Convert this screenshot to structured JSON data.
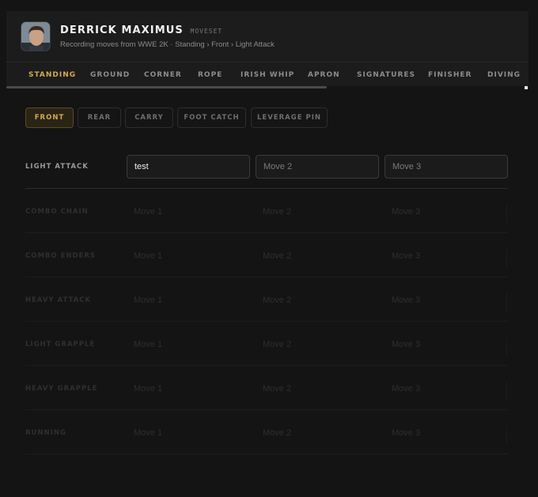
{
  "header": {
    "name": "DERRICK MAXIMUS",
    "badge": "MOVESET",
    "subtitle": "Recording moves from WWE 2K · Standing › Front › Light Attack"
  },
  "tabs": [
    {
      "label": "STANDING",
      "active": true
    },
    {
      "label": "GROUND"
    },
    {
      "label": "CORNER"
    },
    {
      "label": "ROPE"
    },
    {
      "label": "IRISH WHIP"
    },
    {
      "label": "APRON"
    },
    {
      "label": "SIGNATURES"
    },
    {
      "label": "FINISHER"
    },
    {
      "label": "DIVING"
    }
  ],
  "subtabs": [
    {
      "label": "FRONT",
      "active": true
    },
    {
      "label": "REAR"
    },
    {
      "label": "CARRY"
    },
    {
      "label": "FOOT CATCH"
    },
    {
      "label": "LEVERAGE PIN"
    }
  ],
  "rows": [
    {
      "label": "LIGHT ATTACK",
      "active": true,
      "moves": [
        {
          "value": "test",
          "placeholder": "Move 1"
        },
        {
          "value": "",
          "placeholder": "Move 2"
        },
        {
          "value": "",
          "placeholder": "Move 3"
        }
      ]
    },
    {
      "label": "COMBO CHAIN",
      "moves": [
        {
          "placeholder": "Move 1"
        },
        {
          "placeholder": "Move 2"
        },
        {
          "placeholder": "Move 3"
        }
      ]
    },
    {
      "label": "COMBO ENDERS",
      "moves": [
        {
          "placeholder": "Move 1"
        },
        {
          "placeholder": "Move 2"
        },
        {
          "placeholder": "Move 3"
        }
      ]
    },
    {
      "label": "HEAVY ATTACK",
      "moves": [
        {
          "placeholder": "Move 1"
        },
        {
          "placeholder": "Move 2"
        },
        {
          "placeholder": "Move 3"
        }
      ]
    },
    {
      "label": "LIGHT GRAPPLE",
      "moves": [
        {
          "placeholder": "Move 1"
        },
        {
          "placeholder": "Move 2"
        },
        {
          "placeholder": "Move 3"
        }
      ]
    },
    {
      "label": "HEAVY GRAPPLE",
      "moves": [
        {
          "placeholder": "Move 1"
        },
        {
          "placeholder": "Move 2"
        },
        {
          "placeholder": "Move 3"
        }
      ]
    },
    {
      "label": "RUNNING",
      "moves": [
        {
          "placeholder": "Move 1"
        },
        {
          "placeholder": "Move 2"
        },
        {
          "placeholder": "Move 3"
        }
      ]
    }
  ],
  "colors": {
    "accent": "#d4a94f",
    "background": "#141414",
    "panel": "#1c1c1c"
  }
}
